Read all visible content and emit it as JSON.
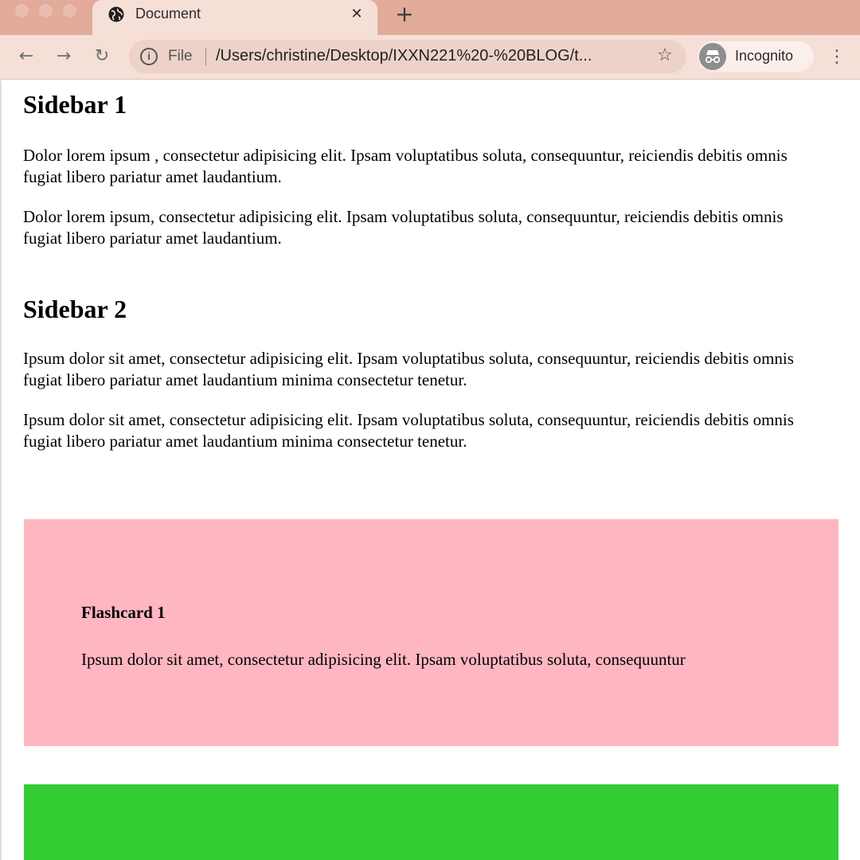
{
  "browser": {
    "tab": {
      "title": "Document",
      "close_glyph": "✕",
      "icon": "globe-icon"
    },
    "new_tab_glyph": "+",
    "toolbar": {
      "back_glyph": "←",
      "forward_glyph": "→",
      "reload_glyph": "↻",
      "info_glyph": "i",
      "scheme_label": "File",
      "url": "/Users/christine/Desktop/IXXN221%20-%20BLOG/t...",
      "star_glyph": "☆",
      "profile_label": "Incognito",
      "menu_glyph": "⋮"
    },
    "colors": {
      "frame": "#e2ab9a",
      "toolbar": "#f6dfd7",
      "omnibox": "#edd2c9"
    }
  },
  "content": {
    "sidebar1": {
      "heading": "Sidebar 1",
      "paragraphs": [
        "Dolor lorem ipsum , consectetur adipisicing elit. Ipsam voluptatibus soluta, consequuntur, reiciendis debitis omnis fugiat libero pariatur amet laudantium.",
        "Dolor lorem ipsum, consectetur adipisicing elit. Ipsam voluptatibus soluta, consequuntur, reiciendis debitis omnis fugiat libero pariatur amet laudantium."
      ]
    },
    "sidebar2": {
      "heading": "Sidebar 2",
      "paragraphs": [
        "Ipsum dolor sit amet, consectetur adipisicing elit. Ipsam voluptatibus soluta, consequuntur, reiciendis debitis omnis fugiat libero pariatur amet laudantium minima consectetur tenetur.",
        "Ipsum dolor sit amet, consectetur adipisicing elit. Ipsam voluptatibus soluta, consequuntur, reiciendis debitis omnis fugiat libero pariatur amet laudantium minima consectetur tenetur."
      ]
    },
    "flashcards": [
      {
        "title": "Flashcard 1",
        "body": "Ipsum dolor sit amet, consectetur adipisicing elit. Ipsam voluptatibus soluta, consequuntur",
        "color": "#feb6c1"
      },
      {
        "color": "#33cc33"
      }
    ]
  }
}
